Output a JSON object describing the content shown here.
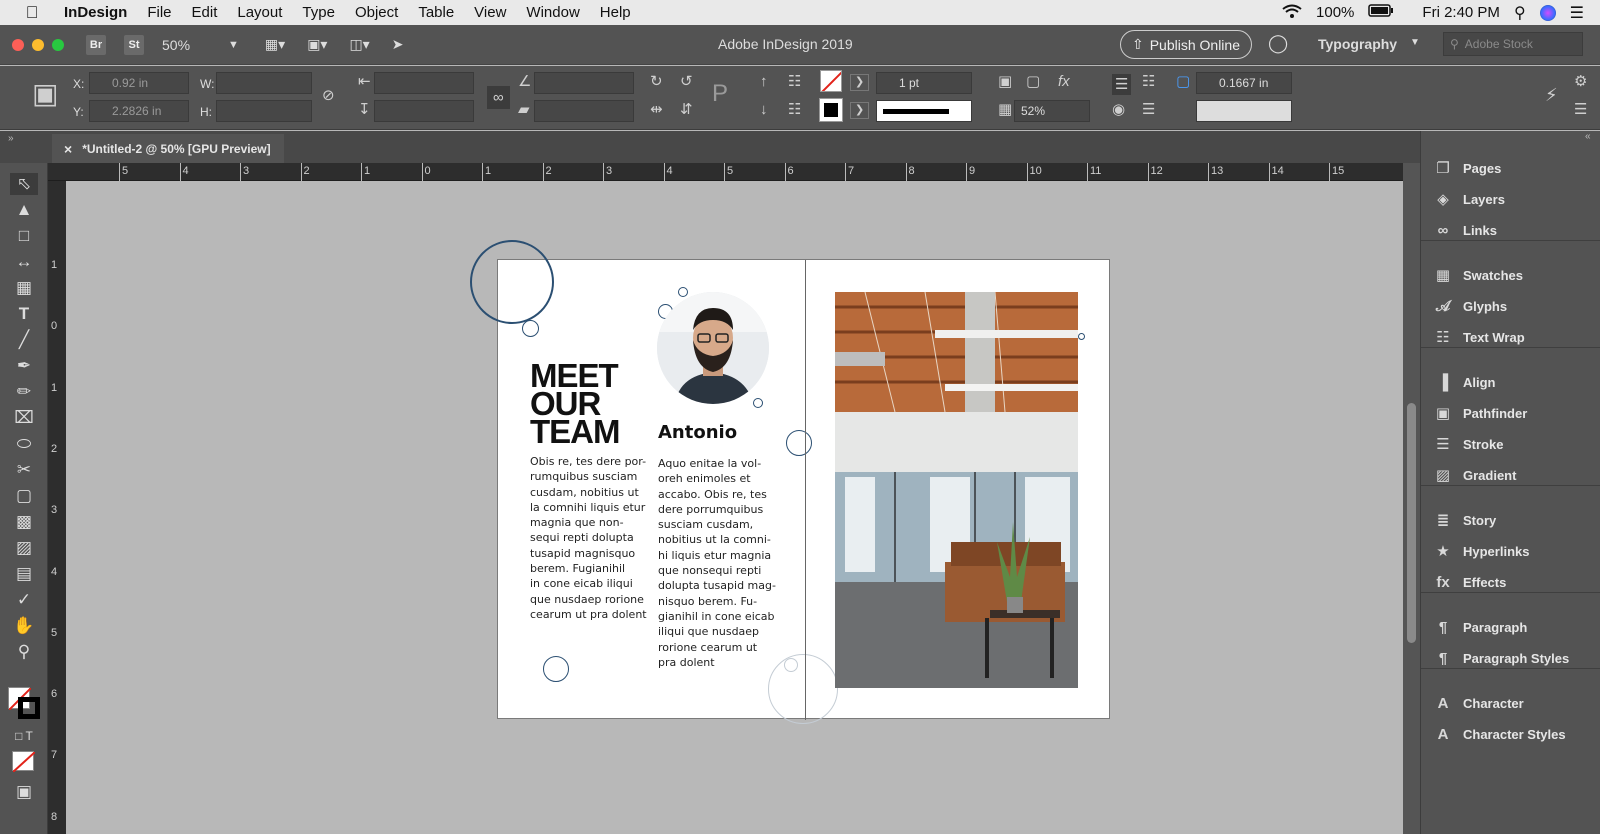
{
  "menubar": {
    "app": "InDesign",
    "items": [
      "File",
      "Edit",
      "Layout",
      "Type",
      "Object",
      "Table",
      "View",
      "Window",
      "Help"
    ],
    "battery": "100%",
    "clock": "Fri 2:40 PM"
  },
  "appbar": {
    "bridge": "Br",
    "stock_chip": "St",
    "zoom": "50%",
    "title": "Adobe InDesign 2019",
    "publish": "Publish Online",
    "workspace": "Typography",
    "search_placeholder": "Adobe Stock"
  },
  "control": {
    "x_label": "X:",
    "x_value": "0.92 in",
    "y_label": "Y:",
    "y_value": "2.2826 in",
    "w_label": "W:",
    "h_label": "H:",
    "stroke_weight": "1 pt",
    "scale": "52%",
    "offset": "0.1667 in"
  },
  "tab": {
    "title": "*Untitled-2 @ 50% [GPU Preview]"
  },
  "ruler": {
    "h_ticks": [
      "5",
      "4",
      "3",
      "2",
      "1",
      "0",
      "1",
      "2",
      "3",
      "4",
      "5",
      "6",
      "7",
      "8",
      "9",
      "10",
      "11",
      "12",
      "13",
      "14",
      "15"
    ],
    "v_ticks": [
      "1",
      "0",
      "1",
      "2",
      "3",
      "4",
      "5",
      "6",
      "7",
      "8"
    ]
  },
  "panels": [
    {
      "label": "Pages",
      "icon": "pages-icon"
    },
    {
      "label": "Layers",
      "icon": "layers-icon"
    },
    {
      "label": "Links",
      "icon": "links-icon"
    },
    {
      "label": "Swatches",
      "icon": "swatches-icon"
    },
    {
      "label": "Glyphs",
      "icon": "glyphs-icon"
    },
    {
      "label": "Text Wrap",
      "icon": "text-wrap-icon"
    },
    {
      "label": "Align",
      "icon": "align-icon"
    },
    {
      "label": "Pathfinder",
      "icon": "pathfinder-icon"
    },
    {
      "label": "Stroke",
      "icon": "stroke-icon"
    },
    {
      "label": "Gradient",
      "icon": "gradient-icon"
    },
    {
      "label": "Story",
      "icon": "story-icon"
    },
    {
      "label": "Hyperlinks",
      "icon": "hyperlinks-icon"
    },
    {
      "label": "Effects",
      "icon": "effects-icon"
    },
    {
      "label": "Paragraph",
      "icon": "paragraph-icon"
    },
    {
      "label": "Paragraph Styles",
      "icon": "paragraph-styles-icon"
    },
    {
      "label": "Character",
      "icon": "character-icon"
    },
    {
      "label": "Character Styles",
      "icon": "character-styles-icon"
    }
  ],
  "document": {
    "headline_1": "MEET",
    "headline_2": "OUR",
    "headline_3": "TEAM",
    "col1": "Obis re, tes dere por-\nrumquibus susciam\ncusdam, nobitius ut\nla comnihi liquis etur\nmagnia que non-\nsequi repti dolupta\ntusapid magnisquo\nberem. Fugianihil\nin cone eicab iliqui\nque nusdaep rorione\ncearum ut pra dolent",
    "name": "Antonio",
    "col2": "Aquo enitae la vol-\noreh enimoles et\naccabo. Obis re, tes\ndere porrumquibus\nsusciam cusdam,\nnobitius ut la comni-\nhi liquis etur magnia\nque nonsequi repti\ndolupta tusapid mag-\nnisquo berem. Fu-\ngianihil in cone eicab\niliqui que nusdaep\nrorione cearum ut\npra dolent"
  },
  "colors": {
    "accent_blue": "#2b4f72",
    "ui_dark": "#535353"
  }
}
